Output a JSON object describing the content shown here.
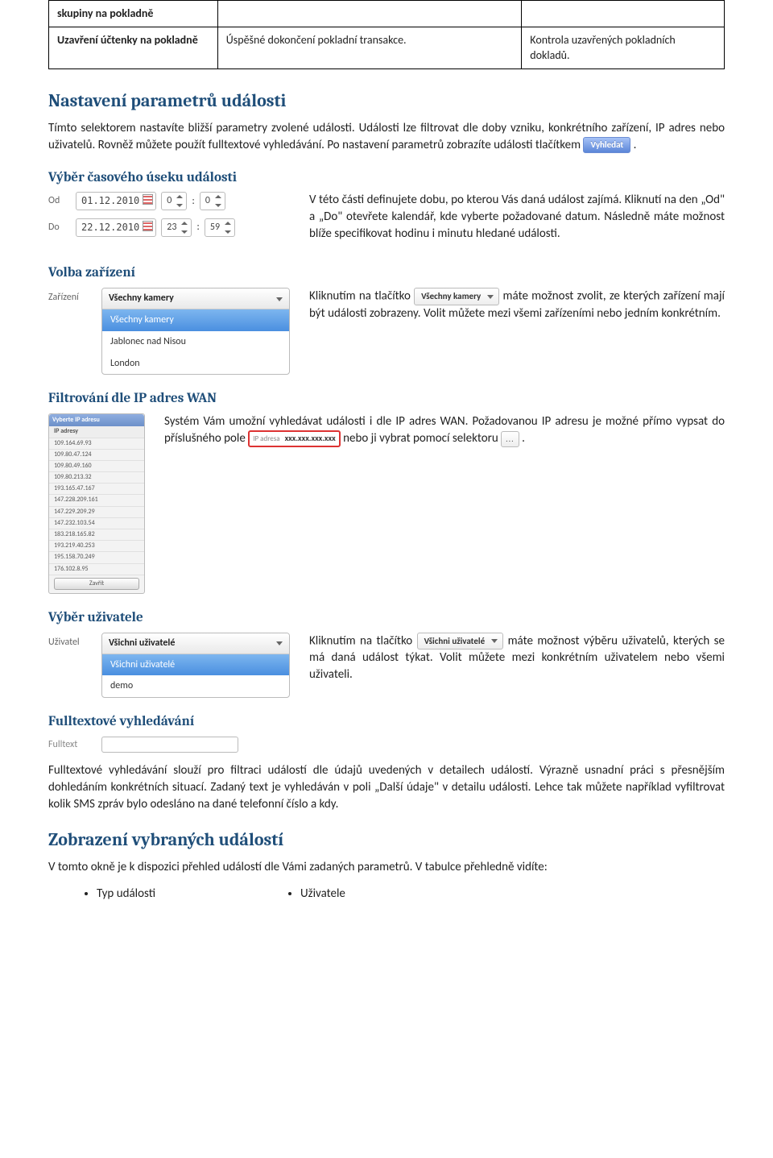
{
  "table": {
    "rows": [
      {
        "c1": "skupiny na pokladně",
        "c2": "",
        "c3": "",
        "c1_bold": true
      },
      {
        "c1": "Uzavření účtenky na pokladně",
        "c2": "Úspěšné dokončení pokladní transakce.",
        "c3": "Kontrola uzavřených pokladních dokladů.",
        "c1_bold": true
      }
    ]
  },
  "section_params": {
    "heading": "Nastavení parametrů události",
    "para1_a": "Tímto selektorem nastavíte bližší parametry zvolené události. Události lze filtrovat dle doby vzniku, konkrétního zařízení, IP adres nebo uživatelů. Rovněž můžete použít fulltextové vyhledávání.  Po nastavení parametrů zobrazíte události tlačítkem ",
    "btn_search": "Vyhledat",
    "para1_b": "."
  },
  "section_time": {
    "heading": "Výběr časového úseku události",
    "od_label": "Od",
    "do_label": "Do",
    "od_date": "01.12.2010",
    "do_date": "22.12.2010",
    "od_h": "0",
    "od_m": "0",
    "do_h": "23",
    "do_m": "59",
    "colon": ":",
    "para": "V této části definujete dobu, po kterou Vás daná událost zajímá. Kliknutí na den „Od\" a „Do\" otevřete kalendář, kde vyberte požadované datum. Následně máte možnost blíže specifikovat hodinu i minutu hledané události."
  },
  "section_device": {
    "heading": "Volba zařízení",
    "label": "Zařízení",
    "selected": "Všechny kamery",
    "options": [
      "Všechny kamery",
      "Jablonec nad Nisou",
      "London"
    ],
    "para_a": "Kliknutím na tlačítko ",
    "dd_inline": "Všechny kamery",
    "para_b": " máte možnost zvolit, ze kterých zařízení mají být události zobrazeny. Volit můžete mezi všemi zařízeními nebo jedním konkrétním."
  },
  "section_ip": {
    "heading": "Filtrování dle IP adres WAN",
    "para_a": "Systém Vám umožní vyhledávat události i dle IP adres WAN. Požadovanou IP adresu je možné přímo vypsat do příslušného pole ",
    "ip_label": "IP adresa",
    "ip_value": "xxx.xxx.xxx.xxx",
    "para_b": " nebo ji vybrat pomocí selektoru ",
    "sel_dots": "...",
    "para_c": ".",
    "list_header": "Vyberte IP adresu",
    "list_sub": "IP adresy",
    "list_items": [
      "109.164.69.93",
      "109.80.47.124",
      "109.80.49.160",
      "109.80.213.32",
      "193.165.47.167",
      "147.228.209.161",
      "147.229.209.29",
      "147.232.103.54",
      "183.218.165.82",
      "193.219.40.253",
      "195.158.70.249",
      "176.102.8.95"
    ],
    "list_close": "Zavřít"
  },
  "section_user": {
    "heading": "Výběr uživatele",
    "label": "Uživatel",
    "selected": "Všichni uživatelé",
    "options": [
      "Všichni uživatelé",
      "demo"
    ],
    "para_a": "Kliknutím na tlačítko ",
    "dd_inline": "Všichni uživatelé",
    "para_b": " máte možnost výběru uživatelů, kterých se má daná událost týkat. Volit můžete mezi konkrétním uživatelem nebo všemi uživateli."
  },
  "section_fulltext": {
    "heading": "Fulltextové vyhledávání",
    "label": "Fulltext",
    "para": "Fulltextové vyhledávání slouží pro filtraci událostí dle údajů uvedených v detailech událostí. Výrazně usnadní práci s přesnějším dohledáním konkrétních situací. Zadaný text je vyhledáván v poli „Další údaje\" v detailu události. Lehce tak můžete například vyfiltrovat kolik SMS zpráv bylo odesláno na dané telefonní číslo a kdy."
  },
  "section_results": {
    "heading": "Zobrazení vybraných událostí",
    "para": "V tomto okně je k dispozici přehled událostí dle Vámi zadaných parametrů.  V tabulce přehledně vidíte:",
    "bullet1": "Typ události",
    "bullet2": "Uživatele"
  }
}
